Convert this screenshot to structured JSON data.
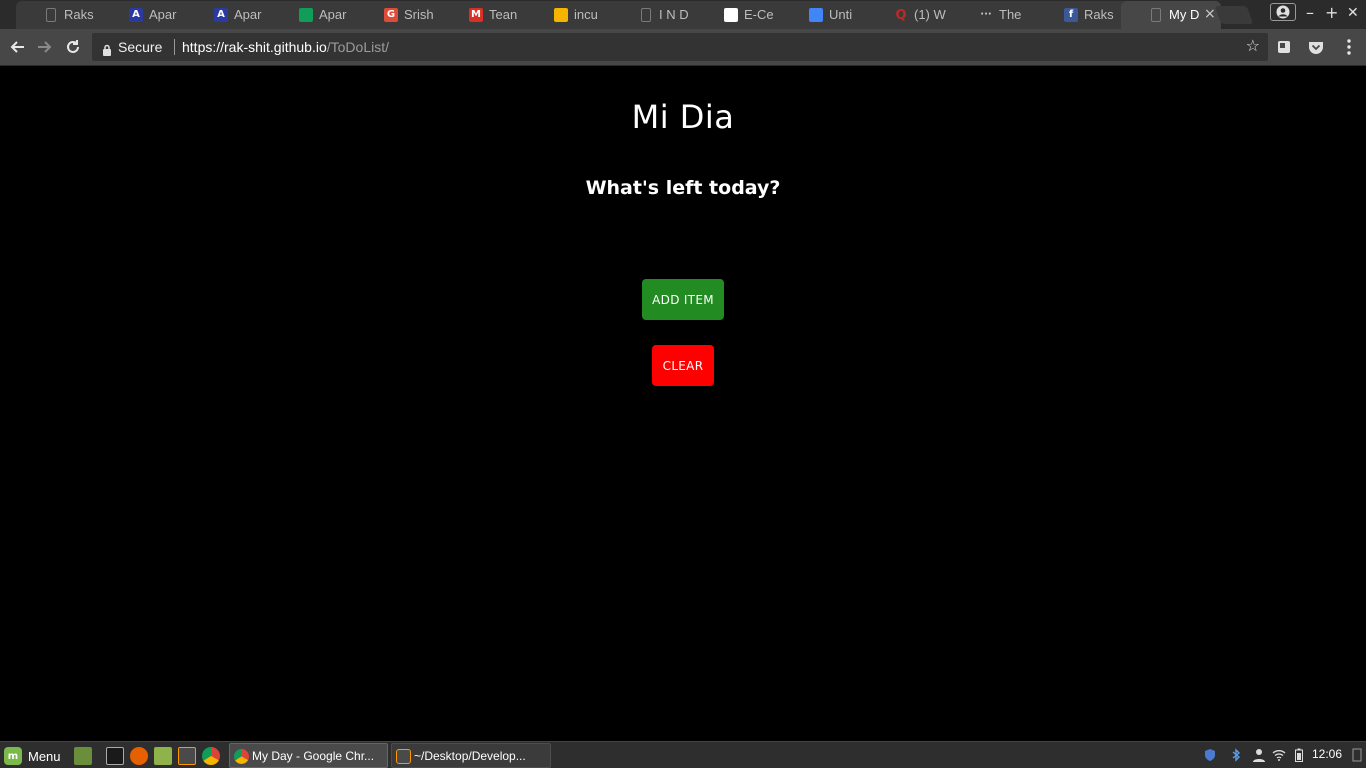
{
  "browser": {
    "tabs": [
      {
        "title": "Raks",
        "icon": "document-icon",
        "color": "#7a7a7a"
      },
      {
        "title": "Apar",
        "icon": "apartment-icon",
        "color": "#2a3aa0"
      },
      {
        "title": "Apar",
        "icon": "apartment-icon",
        "color": "#2a3aa0"
      },
      {
        "title": "Apar",
        "icon": "sheets-icon",
        "color": "#0f9d58"
      },
      {
        "title": "Srish",
        "icon": "google-plus-icon",
        "color": "#dd4b39"
      },
      {
        "title": "Tean",
        "icon": "gmail-icon",
        "color": "#d93025"
      },
      {
        "title": "incu",
        "icon": "slides-icon",
        "color": "#f4b400"
      },
      {
        "title": "I N D",
        "icon": "document-icon",
        "color": "#7a7a7a"
      },
      {
        "title": "E-Ce",
        "icon": "ecell-icon",
        "color": "#ffffff"
      },
      {
        "title": "Unti",
        "icon": "docs-icon",
        "color": "#4285f4"
      },
      {
        "title": "(1) W",
        "icon": "quora-icon",
        "color": "#b92b27"
      },
      {
        "title": "The",
        "icon": "dots-icon",
        "color": "#cccccc"
      },
      {
        "title": "Raks",
        "icon": "facebook-icon",
        "color": "#3b5998"
      },
      {
        "title": "My D",
        "icon": "document-icon",
        "color": "#7a7a7a",
        "active": true
      }
    ],
    "close_glyph": "×",
    "window_controls": {
      "minimize": "–",
      "maximize": "+",
      "close": "✕"
    },
    "security_label": "Secure",
    "url": {
      "scheme_host": "https://rak-shit.github.io",
      "path": "/ToDoList/"
    }
  },
  "page": {
    "title": "Mi Dia",
    "subtitle": "What's left today?",
    "add_button_label": "ADD ITEM",
    "clear_button_label": "CLEAR",
    "colors": {
      "add": "#228b22",
      "clear": "#ff0000",
      "background": "#000000"
    }
  },
  "taskbar": {
    "menu_label": "Menu",
    "tasks": [
      {
        "label": "My Day - Google Chr...",
        "icon": "chrome-icon",
        "active": true
      },
      {
        "label": "~/Desktop/Develop...",
        "icon": "sublime-icon",
        "active": false
      }
    ],
    "clock": "12:06"
  }
}
